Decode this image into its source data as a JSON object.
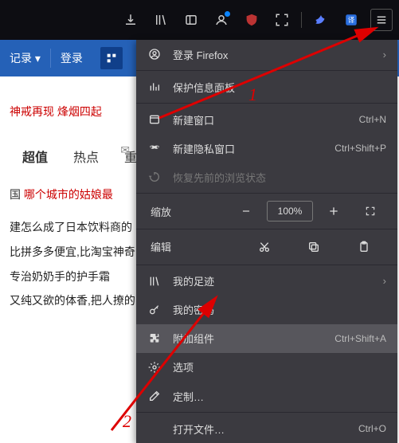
{
  "toolbar": {
    "icons": [
      "download",
      "library",
      "sidebar",
      "account",
      "ublock",
      "crop",
      "separator",
      "bird",
      "translate",
      "menu"
    ]
  },
  "page": {
    "bluebar": {
      "item1": "记录 ▾",
      "item2": "登录"
    },
    "redline1": "神戒再现 烽烟四起",
    "tabs": {
      "t1": "超值",
      "t2": "热点",
      "t3": "重"
    },
    "news": {
      "prefix": "国",
      "red": "哪个城市的姑娘最"
    },
    "body": {
      "l1": "建怎么成了日本饮料商的",
      "l2": "比拼多多便宜,比淘宝神奇",
      "l3": "专治奶奶手的护手霜",
      "l4": "又纯又欲的体香,把人撩的"
    }
  },
  "menu": {
    "login": "登录 Firefox",
    "protect": "保护信息面板",
    "newwin": "新建窗口",
    "newwin_sc": "Ctrl+N",
    "newpriv": "新建隐私窗口",
    "newpriv_sc": "Ctrl+Shift+P",
    "restore": "恢复先前的浏览状态",
    "zoom": "缩放",
    "zoom_pct": "100%",
    "edit": "编辑",
    "history": "我的足迹",
    "passwords": "我的密码",
    "addons": "附加组件",
    "addons_sc": "Ctrl+Shift+A",
    "options": "选项",
    "customize": "定制…",
    "openfile": "打开文件…",
    "openfile_sc": "Ctrl+O"
  },
  "annotations": {
    "n1": "1",
    "n2": "2"
  }
}
